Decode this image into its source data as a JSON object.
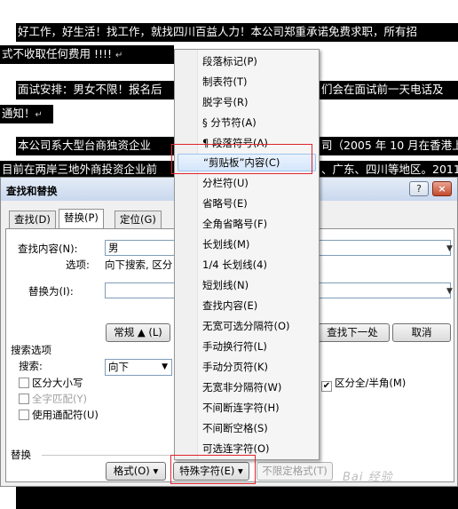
{
  "document": {
    "lines": [
      "好工作，好生活！找工作，就找四川百益人力！本公司郑重承诺免费求职，所有招",
      "式不收取任何费用  !!!!",
      "面试安排：男女不限！报名后",
      "们会在面试前一天电话及",
      "通知！",
      "本公司系大型台商独资企业",
      "司（2005 年 10 月在香港上",
      "目前在两岸三地外商投资企业前",
      "、广东、四川等地区。2011"
    ],
    "paragraph_mark": "↵"
  },
  "dialog": {
    "title": "查找和替换",
    "help_button": "?",
    "close_button": "×",
    "tabs": [
      "查找(D)",
      "替换(P)",
      "定位(G)"
    ],
    "find_label": "查找内容(N):",
    "find_value": "男",
    "options_label": "选项:",
    "options_value": "向下搜索, 区分",
    "replace_label": "替换为(I):",
    "replace_value": "",
    "less_button": "常规 ▲ (L)",
    "find_next_button": "查找下一处",
    "cancel_button": "取消",
    "search_options_title": "搜索选项",
    "search_label": "搜索:",
    "search_direction": "向下",
    "match_case": "区分大小写",
    "whole_word": "全字匹配(Y)",
    "wildcards": "使用通配符(U)",
    "match_width": "区分全/半角(M)",
    "replace_section": "替换",
    "format_button": "格式(O) ▾",
    "special_button": "特殊字符(E) ▾",
    "no_format_button": "不限定格式(T)"
  },
  "menu": {
    "items": [
      "段落标记(P)",
      "制表符(T)",
      "脱字号(R)",
      "§ 分节符(A)",
      "¶ 段落符号(A)",
      "“剪贴板”内容(C)",
      "分栏符(U)",
      "省略号(E)",
      "全角省略号(F)",
      "长划线(M)",
      "1/4 长划线(4)",
      "短划线(N)",
      "查找内容(E)",
      "无宽可选分隔符(O)",
      "手动换行符(L)",
      "手动分页符(K)",
      "无宽非分隔符(W)",
      "不间断连字符(H)",
      "不间断空格(S)",
      "可选连字符(O)"
    ],
    "highlighted_index": 5
  },
  "colors": {
    "highlight_box": "#e0242e",
    "titlebar": "#c9d8ee"
  },
  "watermark": "Bai 经验"
}
